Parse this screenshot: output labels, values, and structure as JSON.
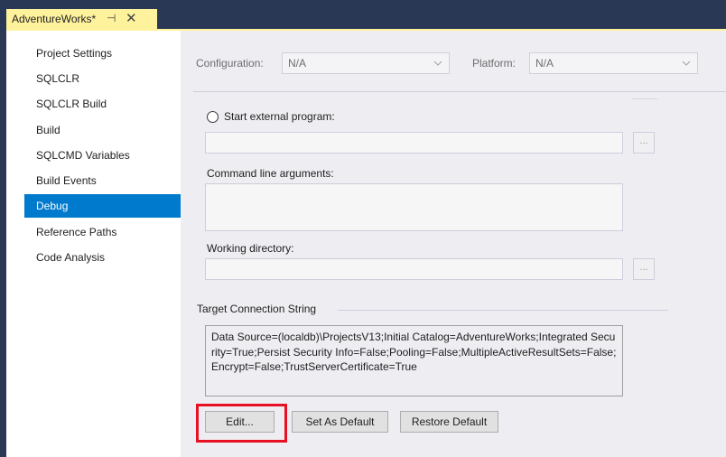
{
  "document_tab": {
    "title": "AdventureWorks*",
    "pin_glyph": "⊣",
    "close_glyph": "✕"
  },
  "sidebar": {
    "items": [
      {
        "label": "Project Settings"
      },
      {
        "label": "SQLCLR"
      },
      {
        "label": "SQLCLR Build"
      },
      {
        "label": "Build"
      },
      {
        "label": "SQLCMD Variables"
      },
      {
        "label": "Build Events"
      },
      {
        "label": "Debug",
        "active": true
      },
      {
        "label": "Reference Paths"
      },
      {
        "label": "Code Analysis"
      }
    ]
  },
  "config_bar": {
    "configuration_label": "Configuration:",
    "configuration_value": "N/A",
    "platform_label": "Platform:",
    "platform_value": "N/A"
  },
  "debug": {
    "start_external_program_label": "Start external program:",
    "start_external_program_value": "",
    "browse_program_label": "...",
    "command_line_arguments_label": "Command line arguments:",
    "command_line_arguments_value": "",
    "working_directory_label": "Working directory:",
    "working_directory_value": "",
    "browse_directory_label": "..."
  },
  "connection": {
    "group_label": "Target Connection String",
    "value": "Data Source=(localdb)\\ProjectsV13;Initial Catalog=AdventureWorks;Integrated Security=True;Persist Security Info=False;Pooling=False;MultipleActiveResultSets=False;Encrypt=False;TrustServerCertificate=True"
  },
  "buttons": {
    "edit_label": "Edit...",
    "set_default_label": "Set As Default",
    "restore_default_label": "Restore Default"
  },
  "colors": {
    "title_strip": "#293955",
    "active_tab": "#fff29d",
    "selected_nav": "#007acc",
    "content_background": "#eeeef2",
    "highlight": "#e81123"
  },
  "icons": {
    "pin": "pin-icon",
    "close": "close-icon",
    "dropdown": "chevron-down-icon",
    "radio": "radio-icon"
  }
}
